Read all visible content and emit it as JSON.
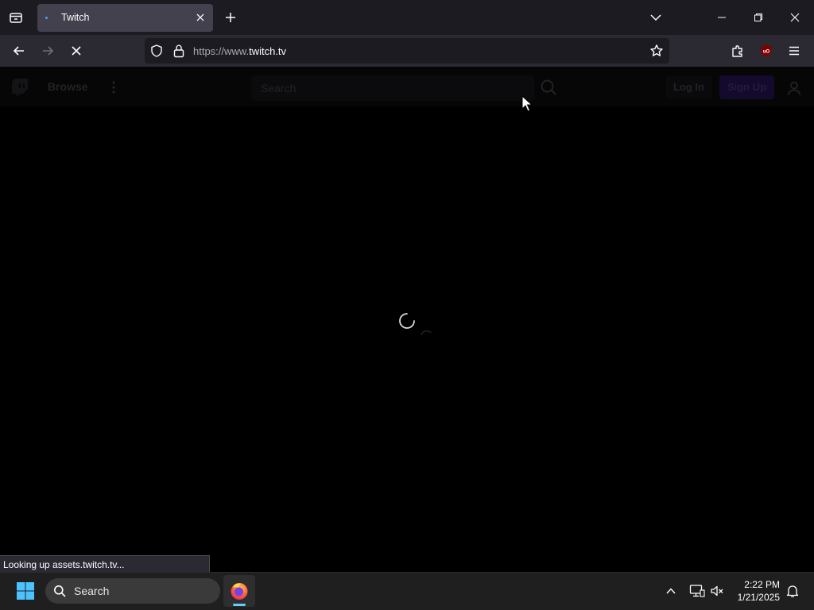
{
  "browser": {
    "tab": {
      "title": "Twitch",
      "loading": true
    },
    "url": {
      "scheme": "https://www.",
      "host": "twitch.tv"
    },
    "status_text": "Looking up assets.twitch.tv...",
    "accent_color": "#4a9eff"
  },
  "twitch": {
    "nav": {
      "browse_label": "Browse"
    },
    "search": {
      "placeholder": "Search"
    },
    "auth": {
      "login_label": "Log In",
      "signup_label": "Sign Up"
    },
    "brand_color": "#9147ff",
    "state": "loading"
  },
  "taskbar": {
    "search_label": "Search",
    "clock": {
      "time": "2:22 PM",
      "date": "1/21/2025"
    },
    "pinned": [
      "firefox-icon"
    ],
    "tray_icons": [
      "chevron-up-icon",
      "display-icon",
      "speaker-muted-icon",
      "notification-bell-icon"
    ]
  }
}
